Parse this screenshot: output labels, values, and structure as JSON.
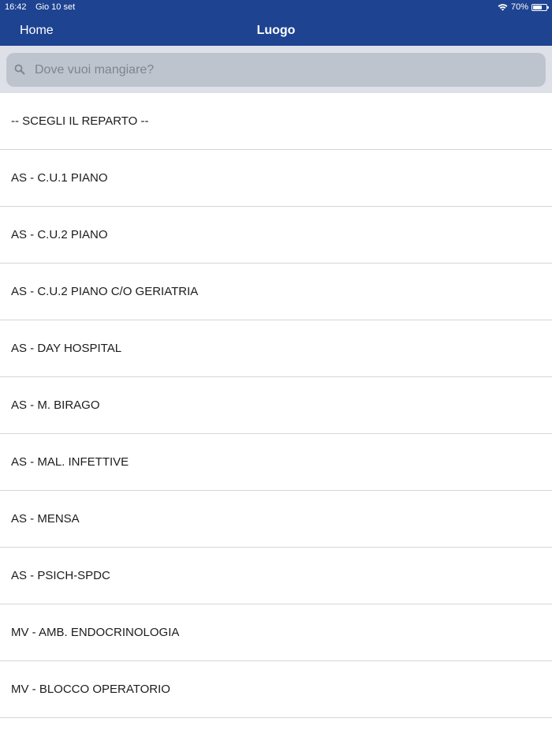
{
  "status_bar": {
    "time": "16:42",
    "date": "Gio 10 set",
    "battery": "70%",
    "battery_level": 0.7
  },
  "nav": {
    "back_label": "Home",
    "title": "Luogo"
  },
  "search": {
    "placeholder": "Dove vuoi mangiare?"
  },
  "list": {
    "items": [
      "-- SCEGLI IL REPARTO --",
      "AS - C.U.1 PIANO",
      "AS - C.U.2 PIANO",
      "AS - C.U.2 PIANO C/O GERIATRIA",
      "AS - DAY HOSPITAL",
      "AS - M. BIRAGO",
      "AS - MAL. INFETTIVE",
      "AS - MENSA",
      "AS - PSICH-SPDC",
      "MV - AMB. ENDOCRINOLOGIA",
      "MV - BLOCCO OPERATORIO"
    ]
  },
  "colors": {
    "nav_bar": "#1e4391",
    "search_area": "#dde1e7",
    "search_box": "#bec4cd"
  }
}
